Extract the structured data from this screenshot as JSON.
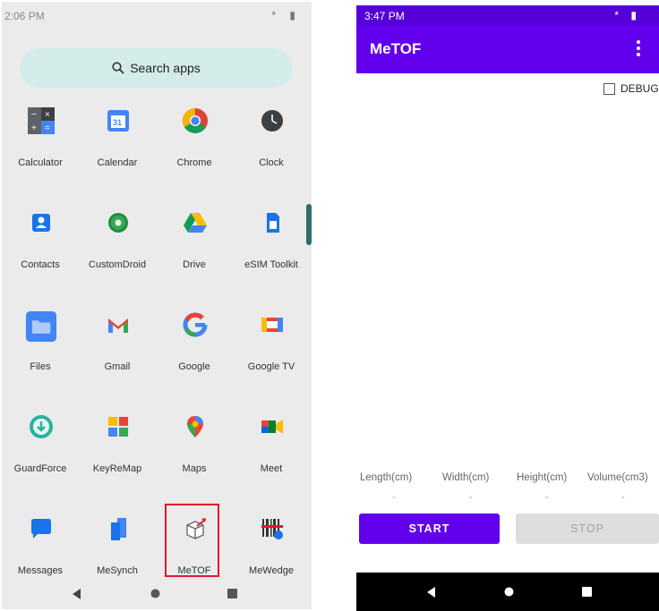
{
  "left": {
    "status": {
      "time": "2:06 PM",
      "icons": "* ▮"
    },
    "search": {
      "label": "Search apps"
    },
    "apps": [
      {
        "label": "Calculator"
      },
      {
        "label": "Calendar"
      },
      {
        "label": "Chrome"
      },
      {
        "label": "Clock"
      },
      {
        "label": "Contacts"
      },
      {
        "label": "CustomDroid"
      },
      {
        "label": "Drive"
      },
      {
        "label": "eSIM Toolkit"
      },
      {
        "label": "Files"
      },
      {
        "label": "Gmail"
      },
      {
        "label": "Google"
      },
      {
        "label": "Google TV"
      },
      {
        "label": "GuardForce"
      },
      {
        "label": "KeyReMap"
      },
      {
        "label": "Maps"
      },
      {
        "label": "Meet"
      },
      {
        "label": "Messages"
      },
      {
        "label": "MeSynch"
      },
      {
        "label": "MeTOF"
      },
      {
        "label": "MeWedge"
      }
    ]
  },
  "right": {
    "status": {
      "time": "3:47 PM",
      "icons": "* ▮"
    },
    "toolbar": {
      "title": "MeTOF"
    },
    "debug": {
      "label": "DEBUG"
    },
    "measurements": [
      {
        "label": "Length(cm)",
        "value": "-"
      },
      {
        "label": "Width(cm)",
        "value": "-"
      },
      {
        "label": "Height(cm)",
        "value": "-"
      },
      {
        "label": "Volume(cm3)",
        "value": "-"
      }
    ],
    "buttons": {
      "start": "START",
      "stop": "STOP"
    }
  },
  "colors": {
    "primary": "#6200ee",
    "status_bar": "#5600d8",
    "highlight": "#e0192c",
    "search_bg": "#d3ece9"
  }
}
